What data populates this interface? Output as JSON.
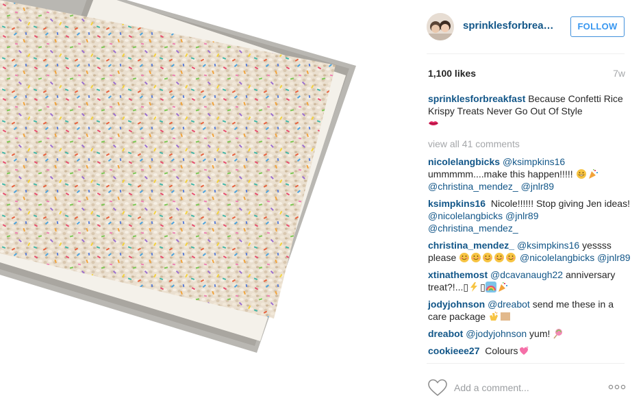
{
  "post": {
    "username": "sprinklesforbreakf...",
    "follow_label": "FOLLOW",
    "likes": "1,100 likes",
    "age": "7w"
  },
  "caption": {
    "username": "sprinklesforbreakfast",
    "text": " Because Confetti Rice Krispy Treats Never Go Out Of Style"
  },
  "view_all": "view all 41 comments",
  "comments": [
    {
      "user": "nicolelangbicks",
      "parts": [
        {
          "m": "@ksimpkins16"
        },
        {
          "t": " ummmmm....make this happen!!!!! "
        },
        {
          "e": "grin"
        },
        {
          "e": "party"
        },
        {
          "t": " "
        },
        {
          "m": "@christina_mendez_"
        },
        {
          "t": " "
        },
        {
          "m": "@jnlr89"
        }
      ]
    },
    {
      "user": "ksimpkins16",
      "parts": [
        {
          "t": " Nicole!!!!!! Stop giving Jen ideas! "
        },
        {
          "m": "@nicolelangbicks"
        },
        {
          "t": " "
        },
        {
          "m": "@jnlr89"
        },
        {
          "t": " "
        },
        {
          "m": "@christina_mendez_"
        }
      ]
    },
    {
      "user": "christina_mendez_",
      "parts": [
        {
          "m": "@ksimpkins16"
        },
        {
          "t": " yessss please "
        },
        {
          "e": "smile"
        },
        {
          "e": "smile"
        },
        {
          "e": "smile"
        },
        {
          "e": "smile"
        },
        {
          "e": "smile"
        },
        {
          "t": " "
        },
        {
          "m": "@nicolelangbicks"
        },
        {
          "t": " "
        },
        {
          "m": "@jnlr89"
        }
      ]
    },
    {
      "user": "xtinathemost",
      "parts": [
        {
          "m": "@dcavanaugh22"
        },
        {
          "t": " anniversary treat?!...▯"
        },
        {
          "e": "zap"
        },
        {
          "t": "▯"
        },
        {
          "e": "rainbow"
        },
        {
          "e": "party"
        }
      ]
    },
    {
      "user": "jodyjohnson",
      "parts": [
        {
          "m": "@dreabot"
        },
        {
          "t": " send me these in a care package "
        },
        {
          "e": "clap"
        },
        {
          "e": "skin"
        }
      ]
    },
    {
      "user": "dreabot",
      "parts": [
        {
          "m": "@jodyjohnson"
        },
        {
          "t": " yum! "
        },
        {
          "e": "lollipop"
        }
      ]
    },
    {
      "user": "cookieee27",
      "parts": [
        {
          "t": " Colours"
        },
        {
          "e": "hearts"
        }
      ]
    }
  ],
  "add_comment": {
    "placeholder": "Add a comment..."
  },
  "icons": {
    "like": "heart-outline-icon",
    "more": "more-options-icon",
    "lips": "lips-emoji-icon"
  },
  "colors": {
    "username_blue": "#125688",
    "follow_blue": "#3897f0",
    "muted": "#a5a7aa"
  }
}
